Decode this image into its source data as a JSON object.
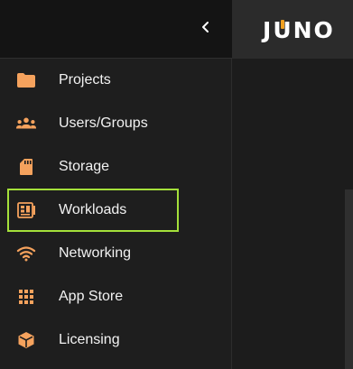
{
  "brand": {
    "logo_before": "J",
    "logo_u": "U",
    "logo_after": "NO",
    "accent": "#f0a020"
  },
  "sidebar": {
    "collapse_icon": "chevron-left-icon",
    "icon_color": "#f5a25d",
    "selected_outline": "#a4e03a",
    "items": [
      {
        "label": "Projects",
        "icon": "folder-icon"
      },
      {
        "label": "Users/Groups",
        "icon": "groups-icon"
      },
      {
        "label": "Storage",
        "icon": "sd-card-icon"
      },
      {
        "label": "Workloads",
        "icon": "workload-icon",
        "selected": true
      },
      {
        "label": "Networking",
        "icon": "wifi-icon"
      },
      {
        "label": "App Store",
        "icon": "apps-grid-icon"
      },
      {
        "label": "Licensing",
        "icon": "license-cube-icon"
      }
    ]
  }
}
